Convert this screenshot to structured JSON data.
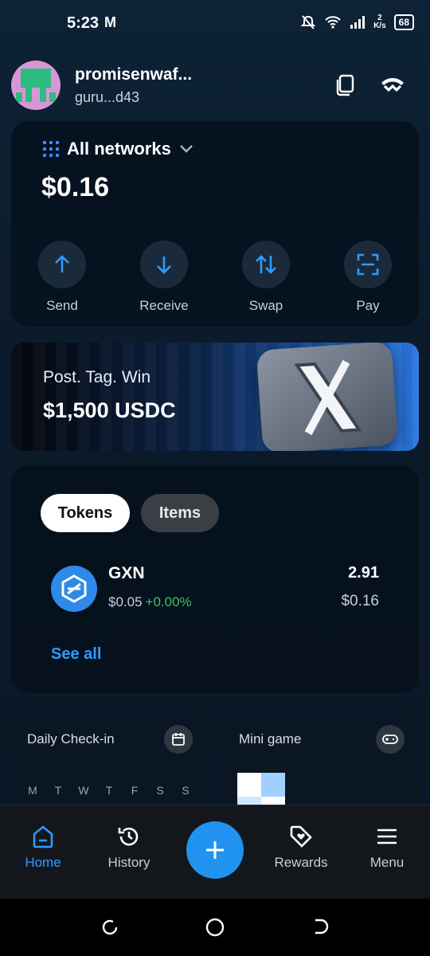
{
  "status_bar": {
    "time": "5:23",
    "mail_icon": "M",
    "net_speed_top": "2",
    "net_speed_unit": "K/s",
    "battery": "68"
  },
  "header": {
    "username": "promisenwaf...",
    "address": "guru...d43"
  },
  "balance_card": {
    "network_label": "All networks",
    "balance": "$0.16",
    "actions": [
      {
        "label": "Send",
        "icon": "arrow-up-icon"
      },
      {
        "label": "Receive",
        "icon": "arrow-down-icon"
      },
      {
        "label": "Swap",
        "icon": "swap-icon"
      },
      {
        "label": "Pay",
        "icon": "scan-icon"
      }
    ]
  },
  "banner": {
    "line1": "Post. Tag. Win",
    "line2": "$1,500 USDC"
  },
  "tokens": {
    "tabs": [
      {
        "label": "Tokens",
        "active": true
      },
      {
        "label": "Items",
        "active": false
      }
    ],
    "list": [
      {
        "name": "GXN",
        "price": "$0.05",
        "change": "+0.00%",
        "quantity": "2.91",
        "value": "$0.16"
      }
    ],
    "see_all": "See all"
  },
  "widgets": {
    "daily_checkin": {
      "title": "Daily Check-in",
      "days": [
        "M",
        "T",
        "W",
        "T",
        "F",
        "S",
        "S"
      ]
    },
    "mini_game": {
      "title": "Mini game"
    }
  },
  "bottom_nav": [
    {
      "label": "Home",
      "active": true
    },
    {
      "label": "History",
      "active": false
    },
    {
      "label": "Rewards",
      "active": false
    },
    {
      "label": "Menu",
      "active": false
    }
  ],
  "colors": {
    "accent": "#2f9bff",
    "positive": "#3bc46a",
    "fab": "#1f93ef"
  }
}
